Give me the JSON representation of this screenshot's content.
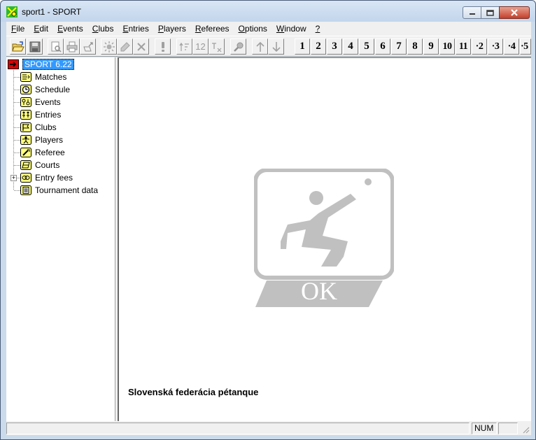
{
  "window": {
    "title": "sport1 - SPORT"
  },
  "menu": [
    {
      "label": "File",
      "key": "F",
      "rest": "ile"
    },
    {
      "label": "Edit",
      "key": "E",
      "rest": "dit"
    },
    {
      "label": "Events",
      "key": "E",
      "rest": "vents"
    },
    {
      "label": "Clubs",
      "key": "C",
      "rest": "lubs"
    },
    {
      "label": "Entries",
      "key": "E",
      "rest": "ntries"
    },
    {
      "label": "Players",
      "key": "P",
      "rest": "layers"
    },
    {
      "label": "Referees",
      "key": "R",
      "rest": "eferees"
    },
    {
      "label": "Options",
      "key": "O",
      "rest": "ptions"
    },
    {
      "label": "Window",
      "key": "W",
      "rest": "indow"
    },
    {
      "label": "?",
      "key": "?",
      "rest": ""
    }
  ],
  "toolbar": {
    "icons": [
      "open-folder-icon",
      "save-icon",
      "print-preview-icon",
      "print-icon",
      "export-icon",
      "sun-icon",
      "pencil-icon",
      "delete-x-icon",
      "exclamation-icon",
      "sort-icon",
      "number-12-icon",
      "text-icon",
      "search-icon",
      "arrow-up-icon",
      "arrow-down-icon"
    ],
    "label_12": "12",
    "numbers": [
      "1",
      "2",
      "3",
      "4",
      "5",
      "6",
      "7",
      "8",
      "9",
      "10",
      "11",
      "·2",
      "·3",
      "·4",
      "·5"
    ]
  },
  "tree": {
    "root": "SPORT 6.22",
    "items": [
      {
        "label": "Matches",
        "icon": "matches-icon"
      },
      {
        "label": "Schedule",
        "icon": "schedule-clock-icon"
      },
      {
        "label": "Events",
        "icon": "events-icon"
      },
      {
        "label": "Entries",
        "icon": "entries-icon"
      },
      {
        "label": "Clubs",
        "icon": "clubs-flag-icon"
      },
      {
        "label": "Players",
        "icon": "players-icon"
      },
      {
        "label": "Referee",
        "icon": "referee-whistle-icon"
      },
      {
        "label": "Courts",
        "icon": "courts-icon"
      },
      {
        "label": "Entry fees",
        "icon": "entry-fees-icon"
      },
      {
        "label": "Tournament data",
        "icon": "tournament-data-icon"
      }
    ],
    "expander": "+"
  },
  "main": {
    "logo_text": "OK",
    "federation": "Slovenská federácia pétanque"
  },
  "status": {
    "num": "NUM"
  },
  "colors": {
    "icon_yellow": "#ffff80",
    "selection": "#3399ff",
    "logo_gray": "#c0c0c0",
    "root_icon_red": "#e00000"
  }
}
